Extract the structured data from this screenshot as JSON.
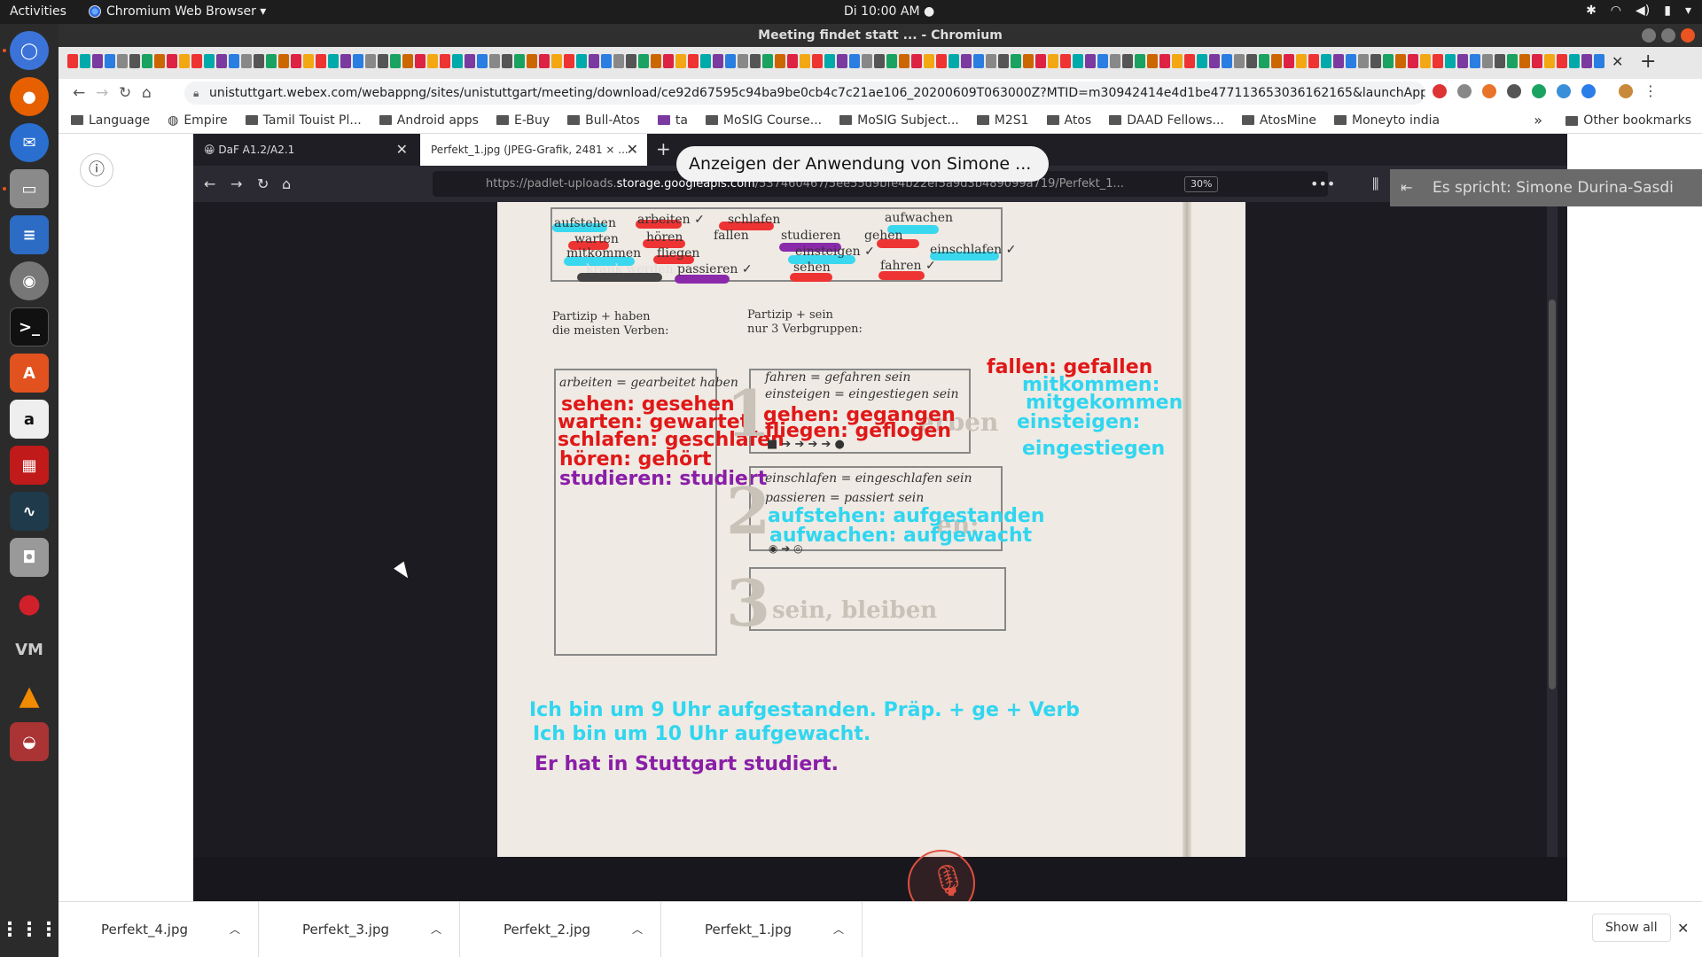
{
  "topbar": {
    "activities": "Activities",
    "app_menu": "Chromium Web Browser ▾",
    "clock": "Di 10:00 AM ●"
  },
  "window": {
    "title": "Meeting findet statt ... - Chromium"
  },
  "toolbar": {
    "url": "unistuttgart.webex.com/webappng/sites/unistuttgart/meeting/download/ce92d67595c94ba9be0cb4c7c21ae106_20200609T063000Z?MTID=m30942414e4d1be477113653036162165&launchApp..."
  },
  "bookmarks": [
    "Language",
    "Empire",
    "Tamil Touist Pl...",
    "Android apps",
    "E-Buy",
    "Bull-Atos",
    "ta",
    "MoSIG Course...",
    "MoSIG Subject...",
    "M2S1",
    "Atos",
    "DAAD Fellows...",
    "AtosMine",
    "Moneyto india"
  ],
  "bookmarks_other": "Other bookmarks",
  "share": {
    "toast": "Anzeigen der Anwendung von Simone ...",
    "speaker": "Es spricht: Simone Durina-Sasdi",
    "ff_tab1": "DaF A1.2/A2.1",
    "ff_tab2": "Perfekt_1.jpg (JPEG-Grafik, 2481 × ...",
    "ff_url_pre": "https://padlet-uploads.",
    "ff_url_host": "storage.googleapis.com",
    "ff_url_post": "/537460467/5ee55d9bfe4b22ef5a9d3b489099a719/Perfekt_1...",
    "zoom": "30%"
  },
  "sheet": {
    "verbs": {
      "aufstehen": "aufstehen",
      "arbeiten": "arbeiten ✓",
      "schlafen": "schlafen",
      "aufwachen": "aufwachen",
      "warten": "warten",
      "hoeren": "hören",
      "fallen": "fallen",
      "studieren": "studieren",
      "gehen": "gehen",
      "mitkommen": "mitkommen",
      "fliegen": "fliegen",
      "einsteigen": "einsteigen ✓",
      "einschlafen": "einschlafen ✓",
      "krank": "krank werden",
      "passieren": "passieren ✓",
      "sehen": "sehen",
      "fahren": "fahren ✓"
    },
    "haben_title": "Partizip + haben",
    "haben_sub": "die meisten Verben:",
    "sein_title": "Partizip + sein",
    "sein_sub": "nur 3 Verbgruppen:",
    "haben_example": "arbeiten = gearbeitet haben",
    "haben_hand": [
      {
        "text": "sehen: gesehen",
        "color": "red"
      },
      {
        "text": "warten: gewartet",
        "color": "red"
      },
      {
        "text": "schlafen: geschlafen",
        "color": "red"
      },
      {
        "text": "hören: gehört",
        "color": "red"
      },
      {
        "text": "studieren: studiert",
        "color": "purple"
      }
    ],
    "g1_ex1": "fahren = gefahren sein",
    "g1_ex2": "einsteigen = eingestiegen sein",
    "g1_hand1": "gehen: gegangen",
    "g1_hand2": "fliegen: geflogen",
    "right_hand": {
      "fallen": "fallen: gefallen",
      "mit1": "mitkommen:",
      "mit2": "mitgekommen",
      "ein1": "einsteigen:",
      "ein2": "eingestiegen"
    },
    "g2_ex1": "einschlafen = eingeschlafen sein",
    "g2_ex2": "passieren = passiert sein",
    "g2_hand1": "aufstehen: aufgestanden",
    "g2_hand2": "aufwachen: aufgewacht",
    "g3_text": "sein, bleiben",
    "num1": "1",
    "num2": "2",
    "num3": "3",
    "ghost1": "erben",
    "ghost2": "en:",
    "sent1": "Ich bin um 9 Uhr aufgestanden. Präp. + ge + Verb",
    "sent2": "Ich bin um 10 Uhr aufgewacht.",
    "sent3": "Er hat in Stuttgart studiert."
  },
  "downloads": {
    "items": [
      "Perfekt_4.jpg",
      "Perfekt_3.jpg",
      "Perfekt_2.jpg",
      "Perfekt_1.jpg"
    ],
    "show_all": "Show all"
  }
}
